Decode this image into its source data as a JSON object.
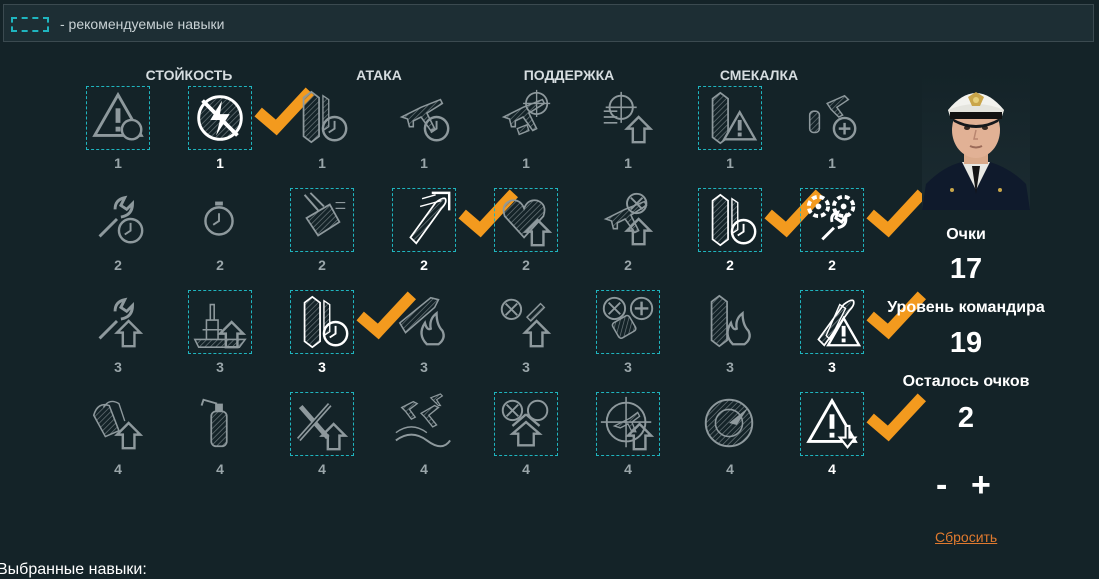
{
  "legend": {
    "text": "- рекомендуемые навыки"
  },
  "columns": [
    "СТОЙКОСТЬ",
    "АТАКА",
    "ПОДДЕРЖКА",
    "СМЕКАЛКА"
  ],
  "colors": {
    "recommended_border": "#1fb5bf",
    "check": "#f39a1e",
    "reset_link": "#e07a2f",
    "background": "#142328"
  },
  "skills": [
    [
      {
        "icon": "alert-circle-icon",
        "level": "1",
        "recommended": true,
        "selected": false
      },
      {
        "icon": "no-lightning-icon",
        "level": "1",
        "recommended": true,
        "selected": true
      },
      {
        "icon": "torpedo-timer-icon",
        "level": "1",
        "recommended": false,
        "selected": false
      },
      {
        "icon": "plane-timer-icon",
        "level": "1",
        "recommended": false,
        "selected": false
      },
      {
        "icon": "planes-crosshair-icon",
        "level": "1",
        "recommended": false,
        "selected": false
      },
      {
        "icon": "crosshair-arrow-icon",
        "level": "1",
        "recommended": false,
        "selected": false
      },
      {
        "icon": "ship-alert-icon",
        "level": "1",
        "recommended": true,
        "selected": false
      },
      {
        "icon": "plane-plus-icon",
        "level": "1",
        "recommended": false,
        "selected": false
      }
    ],
    [
      {
        "icon": "wrench-timer-icon",
        "level": "2",
        "recommended": false,
        "selected": false
      },
      {
        "icon": "stopwatch-icon",
        "level": "2",
        "recommended": false,
        "selected": false
      },
      {
        "icon": "turret-icon",
        "level": "2",
        "recommended": true,
        "selected": false
      },
      {
        "icon": "shell-arrow-icon",
        "level": "2",
        "recommended": true,
        "selected": true
      },
      {
        "icon": "heart-arrow-icon",
        "level": "2",
        "recommended": true,
        "selected": false
      },
      {
        "icon": "plane-target-arrow-icon",
        "level": "2",
        "recommended": false,
        "selected": false
      },
      {
        "icon": "torpedo-timer-icon",
        "level": "2",
        "recommended": true,
        "selected": true
      },
      {
        "icon": "gears-wrench-icon",
        "level": "2",
        "recommended": true,
        "selected": true
      }
    ],
    [
      {
        "icon": "wrench-arrow-icon",
        "level": "3",
        "recommended": false,
        "selected": false
      },
      {
        "icon": "ship-arrow-icon",
        "level": "3",
        "recommended": true,
        "selected": false
      },
      {
        "icon": "torpedo-timer-icon",
        "level": "3",
        "recommended": true,
        "selected": true
      },
      {
        "icon": "plane-fire-icon",
        "level": "3",
        "recommended": false,
        "selected": false
      },
      {
        "icon": "target-shell-arrow-icon",
        "level": "3",
        "recommended": false,
        "selected": false
      },
      {
        "icon": "target-plus-icon",
        "level": "3",
        "recommended": true,
        "selected": false
      },
      {
        "icon": "ship-fire-icon",
        "level": "3",
        "recommended": false,
        "selected": false
      },
      {
        "icon": "torpedo-alert-icon",
        "level": "3",
        "recommended": true,
        "selected": true
      }
    ],
    [
      {
        "icon": "shells-arrow-icon",
        "level": "4",
        "recommended": false,
        "selected": false
      },
      {
        "icon": "extinguisher-icon",
        "level": "4",
        "recommended": false,
        "selected": false
      },
      {
        "icon": "cross-arrow-icon",
        "level": "4",
        "recommended": true,
        "selected": false
      },
      {
        "icon": "planes-wave-icon",
        "level": "4",
        "recommended": false,
        "selected": false
      },
      {
        "icon": "target-double-arrow-icon",
        "level": "4",
        "recommended": true,
        "selected": false
      },
      {
        "icon": "crosshair-plane-icon",
        "level": "4",
        "recommended": true,
        "selected": false
      },
      {
        "icon": "radar-icon",
        "level": "4",
        "recommended": false,
        "selected": false
      },
      {
        "icon": "alert-down-icon",
        "level": "4",
        "recommended": true,
        "selected": true
      }
    ]
  ],
  "panel": {
    "points_label": "Очки",
    "points_value": "17",
    "commander_level_label": "Уровень командира",
    "commander_level_value": "19",
    "remaining_label": "Осталось очков",
    "remaining_value": "2",
    "minus_label": "-",
    "plus_label": "+",
    "reset_label": "Сбросить"
  },
  "footer": {
    "selected_label": "Выбранные навыки:"
  }
}
